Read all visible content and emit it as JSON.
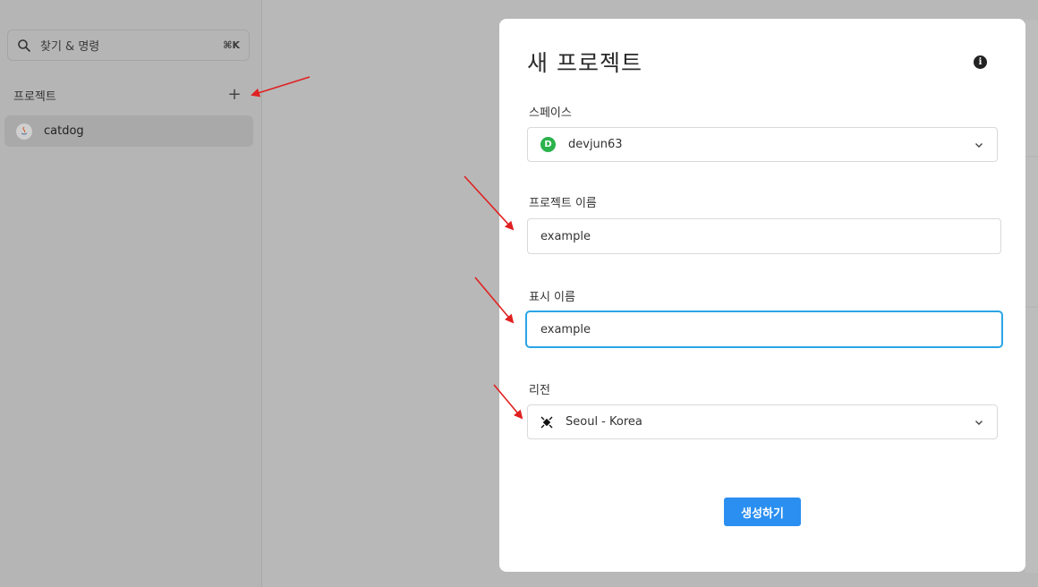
{
  "sidebar": {
    "search_label": "찾기 & 명령",
    "search_shortcut": "⌘K",
    "section_title": "프로젝트",
    "add_label": "+",
    "projects": [
      {
        "label": "catdog",
        "icon": "java-icon"
      }
    ]
  },
  "modal": {
    "title": "새 프로젝트",
    "info_label": "i",
    "space": {
      "label": "스페이스",
      "badge": "D",
      "value": "devjun63",
      "badge_color": "#2bb24c"
    },
    "project_name": {
      "label": "프로젝트 이름",
      "value": "example"
    },
    "display_name": {
      "label": "표시 이름",
      "value": "example"
    },
    "region": {
      "label": "리전",
      "value": "Seoul - Korea",
      "icon": "taegeuk-icon"
    },
    "submit_label": "생성하기"
  },
  "colors": {
    "accent": "#2a8ff0",
    "focus": "#2aa5e6",
    "annotation": "#e02020"
  }
}
